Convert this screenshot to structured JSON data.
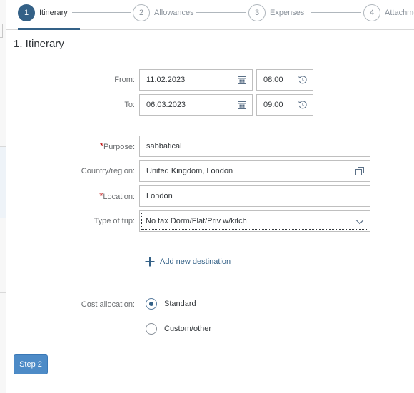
{
  "wizard": {
    "steps": [
      {
        "number": "1",
        "label": "Itinerary"
      },
      {
        "number": "2",
        "label": "Allowances"
      },
      {
        "number": "3",
        "label": "Expenses"
      },
      {
        "number": "4",
        "label": "Attachme"
      }
    ],
    "active_step": 1
  },
  "page_title": "1. Itinerary",
  "itinerary": {
    "from": {
      "label": "From:",
      "date": "11.02.2023",
      "time": "08:00"
    },
    "to": {
      "label": "To:",
      "date": "06.03.2023",
      "time": "09:00"
    }
  },
  "trip": {
    "purpose": {
      "required_mark": "*",
      "label": "Purpose:",
      "value": "sabbatical"
    },
    "country": {
      "label": "Country/region:",
      "value": "United Kingdom, London"
    },
    "location": {
      "required_mark": "*",
      "label": "Location:",
      "value": "London"
    },
    "type_of_trip": {
      "label": "Type of trip:",
      "value": "No tax Dorm/Flat/Priv w/kitch"
    }
  },
  "add_destination_label": "Add new destination",
  "cost_allocation": {
    "label": "Cost allocation:",
    "options": [
      {
        "label": "Standard",
        "selected": true
      },
      {
        "label": "Custom/other",
        "selected": false
      }
    ]
  },
  "footer": {
    "step2_label": "Step 2"
  },
  "colors": {
    "accent": "#346187",
    "button": "#4d8bc7",
    "required": "#bb0000"
  },
  "icons": {
    "date": "calendar-icon",
    "time": "clock-icon",
    "country": "value-help-icon",
    "dropdown": "chevron-down-icon",
    "add": "plus-icon"
  }
}
